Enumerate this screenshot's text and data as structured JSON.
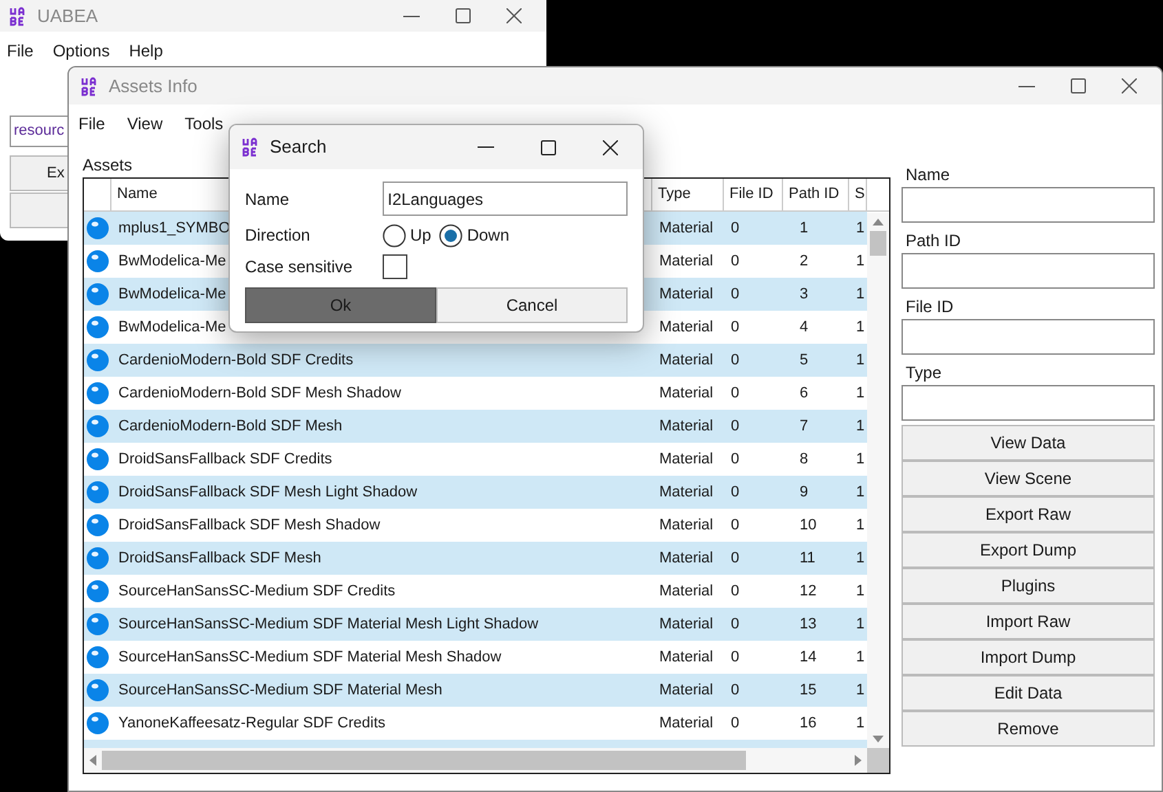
{
  "main_window": {
    "title": "UABEA",
    "menu": [
      "File",
      "Options",
      "Help"
    ],
    "path_field": "resourc",
    "buttons": [
      "Ex"
    ]
  },
  "assets_window": {
    "title": "Assets Info",
    "menu": [
      "File",
      "View",
      "Tools"
    ],
    "section_label": "Assets",
    "table": {
      "columns": [
        "Name",
        "Type",
        "File ID",
        "Path ID",
        "S"
      ],
      "rows": [
        {
          "name": "mplus1_SYMBO",
          "type": "Material",
          "file_id": "0",
          "path_id": "1",
          "column_5": "1"
        },
        {
          "name": "BwModelica-Me",
          "type": "Material",
          "file_id": "0",
          "path_id": "2",
          "column_5": "1"
        },
        {
          "name": "BwModelica-Me",
          "type": "Material",
          "file_id": "0",
          "path_id": "3",
          "column_5": "1"
        },
        {
          "name": "BwModelica-Me",
          "type": "Material",
          "file_id": "0",
          "path_id": "4",
          "column_5": "1"
        },
        {
          "name": "CardenioModern-Bold SDF Credits",
          "type": "Material",
          "file_id": "0",
          "path_id": "5",
          "column_5": "1"
        },
        {
          "name": "CardenioModern-Bold SDF Mesh Shadow",
          "type": "Material",
          "file_id": "0",
          "path_id": "6",
          "column_5": "1"
        },
        {
          "name": "CardenioModern-Bold SDF Mesh",
          "type": "Material",
          "file_id": "0",
          "path_id": "7",
          "column_5": "1"
        },
        {
          "name": "DroidSansFallback SDF Credits",
          "type": "Material",
          "file_id": "0",
          "path_id": "8",
          "column_5": "1"
        },
        {
          "name": "DroidSansFallback SDF Mesh Light Shadow",
          "type": "Material",
          "file_id": "0",
          "path_id": "9",
          "column_5": "1"
        },
        {
          "name": "DroidSansFallback SDF Mesh Shadow",
          "type": "Material",
          "file_id": "0",
          "path_id": "10",
          "column_5": "1"
        },
        {
          "name": "DroidSansFallback SDF Mesh",
          "type": "Material",
          "file_id": "0",
          "path_id": "11",
          "column_5": "1"
        },
        {
          "name": "SourceHanSansSC-Medium SDF Credits",
          "type": "Material",
          "file_id": "0",
          "path_id": "12",
          "column_5": "1"
        },
        {
          "name": "SourceHanSansSC-Medium SDF Material Mesh Light Shadow",
          "type": "Material",
          "file_id": "0",
          "path_id": "13",
          "column_5": "1"
        },
        {
          "name": "SourceHanSansSC-Medium SDF Material Mesh Shadow",
          "type": "Material",
          "file_id": "0",
          "path_id": "14",
          "column_5": "1"
        },
        {
          "name": "SourceHanSansSC-Medium SDF Material Mesh",
          "type": "Material",
          "file_id": "0",
          "path_id": "15",
          "column_5": "1"
        },
        {
          "name": "YanoneKaffeesatz-Regular SDF Credits",
          "type": "Material",
          "file_id": "0",
          "path_id": "16",
          "column_5": "1"
        }
      ]
    },
    "fields": [
      "Name",
      "Path ID",
      "File ID",
      "Type"
    ],
    "buttons": [
      "View Data",
      "View Scene",
      "Export Raw",
      "Export Dump",
      "Plugins",
      "Import Raw",
      "Import Dump",
      "Edit Data",
      "Remove"
    ]
  },
  "search_dialog": {
    "title": "Search",
    "name_label": "Name",
    "name_value": "I2Languages",
    "direction_label": "Direction",
    "directions": [
      {
        "label": "Up",
        "selected": false
      },
      {
        "label": "Down",
        "selected": true
      }
    ],
    "case_sensitive": {
      "label": "Case sensitive",
      "checked": false
    },
    "buttons": [
      {
        "label": "Ok",
        "kind": "default"
      },
      {
        "label": "Cancel",
        "kind": "normal"
      }
    ]
  }
}
